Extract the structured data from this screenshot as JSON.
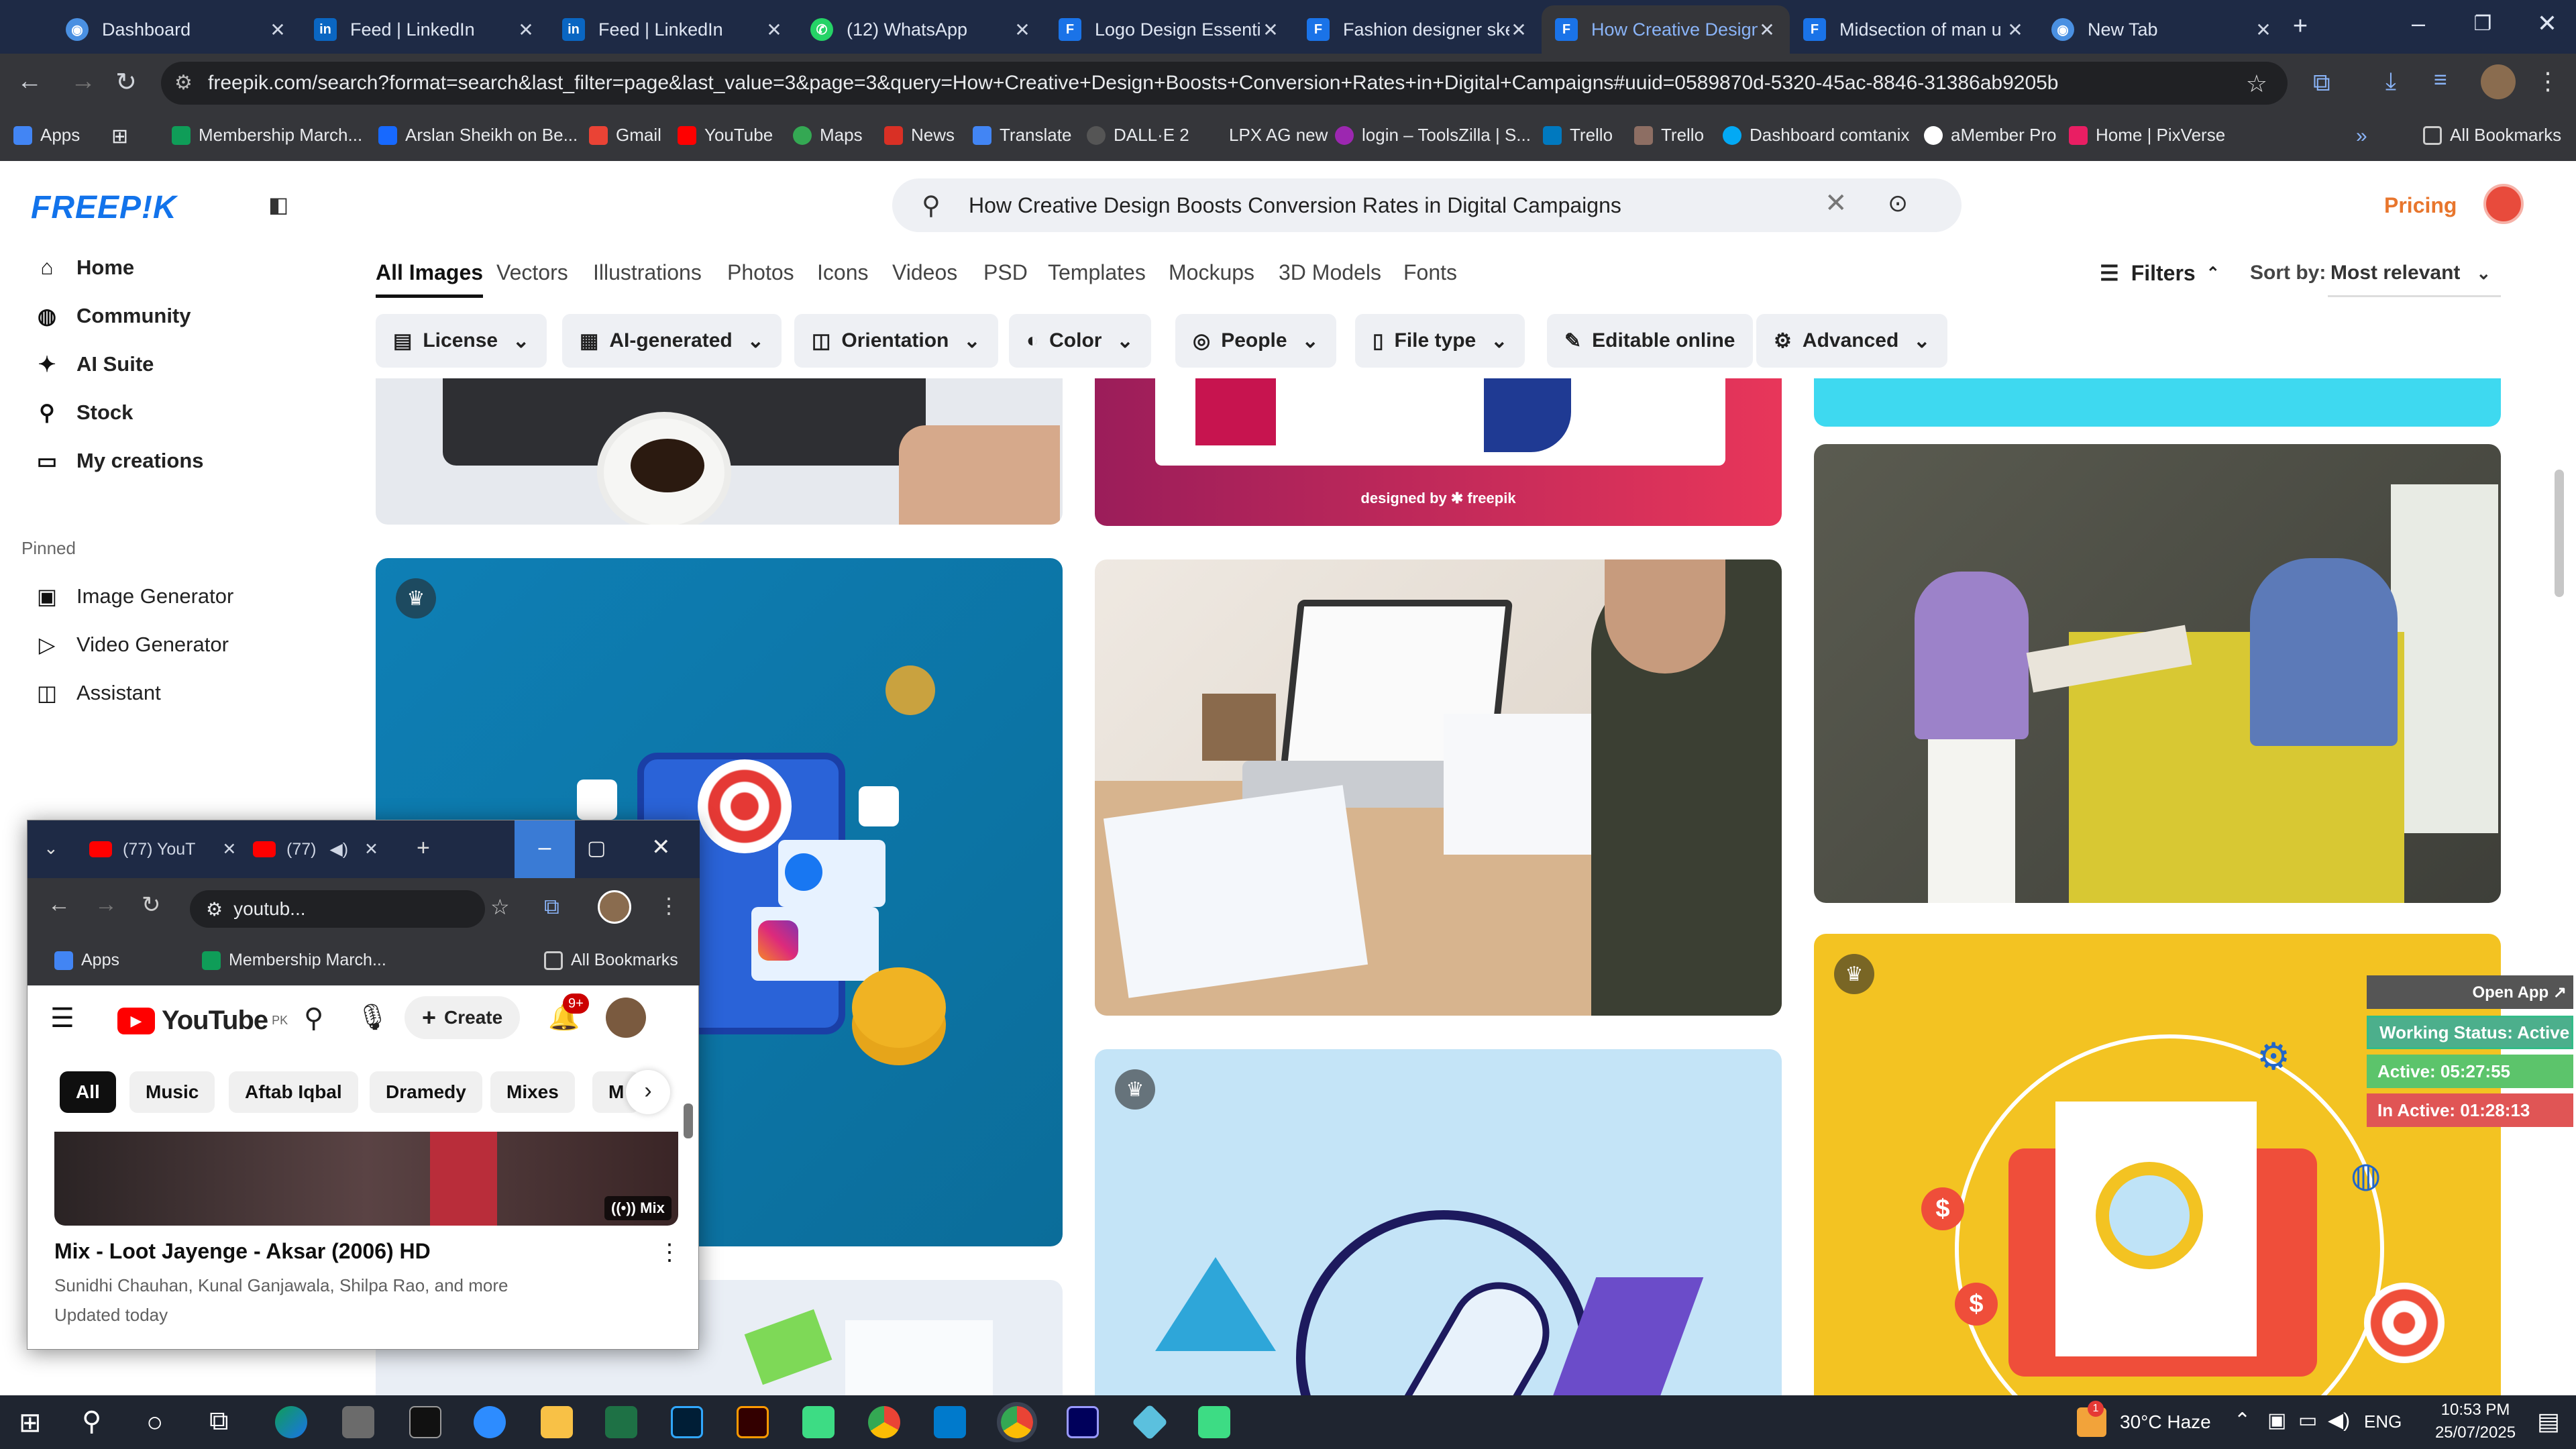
{
  "browser": {
    "tabs": [
      {
        "title": "Dashboard",
        "color": "#4a90e2"
      },
      {
        "title": "Feed | LinkedIn",
        "color": "#0a66c2"
      },
      {
        "title": "Feed | LinkedIn",
        "color": "#0a66c2"
      },
      {
        "title": "(12) WhatsApp",
        "color": "#25d366"
      },
      {
        "title": "Logo Design Essenti",
        "color": "#1a73e8"
      },
      {
        "title": "Fashion designer ske",
        "color": "#1a73e8"
      },
      {
        "title": "How Creative Design",
        "color": "#1a73e8"
      },
      {
        "title": "Midsection of man u",
        "color": "#1a73e8"
      },
      {
        "title": "New Tab",
        "color": "#4a90e2"
      }
    ],
    "url": "freepik.com/search?format=search&last_filter=page&last_value=3&page=3&query=How+Creative+Design+Boosts+Conversion+Rates+in+Digital+Campaigns#uuid=0589870d-5320-45ac-8846-31386ab9205b",
    "bookmarks": [
      "Apps",
      "Membership March...",
      "Arslan Sheikh on Be...",
      "Gmail",
      "YouTube",
      "Maps",
      "News",
      "Translate",
      "DALL·E 2",
      "LPX AG new",
      "login – ToolsZilla | S...",
      "Trello",
      "Trello",
      "Dashboard comtanix",
      "aMember Pro",
      "Home | PixVerse"
    ],
    "all_bookmarks": "All Bookmarks"
  },
  "freepik": {
    "logo": "FREEP!K",
    "search_query": "How Creative Design Boosts Conversion Rates in Digital Campaigns",
    "pricing": "Pricing",
    "sidebar": {
      "items": [
        "Home",
        "Community",
        "AI Suite",
        "Stock",
        "My creations"
      ],
      "pinned_heading": "Pinned",
      "pinned": [
        "Image Generator",
        "Video Generator",
        "Assistant"
      ]
    },
    "tabs": [
      "All Images",
      "Vectors",
      "Illustrations",
      "Photos",
      "Icons",
      "Videos",
      "PSD",
      "Templates",
      "Mockups",
      "3D Models",
      "Fonts"
    ],
    "filters_label": "Filters",
    "sort_label": "Sort by:",
    "sort_value": "Most relevant",
    "chips": [
      "License",
      "AI-generated",
      "Orientation",
      "Color",
      "People",
      "File type",
      "Editable online",
      "Advanced"
    ],
    "designed_by": "designed by ✱ freepik"
  },
  "youtube": {
    "tabs": [
      "(77) YouT",
      "(77)"
    ],
    "url": "youtub...",
    "bookmarks": [
      "Apps",
      "Membership March...",
      "All Bookmarks"
    ],
    "logo": "YouTube",
    "region": "PK",
    "create": "Create",
    "notif_count": "9+",
    "chips": [
      "All",
      "Music",
      "Aftab Iqbal",
      "Dramedy",
      "Mixes",
      "M"
    ],
    "mix_badge": "Mix",
    "video_title": "Mix - Loot Jayenge - Aksar (2006) HD",
    "video_channel": "Sunidhi Chauhan, Kunal Ganjawala, Shilpa Rao, and more",
    "video_updated": "Updated today"
  },
  "tracker": {
    "open_app": "Open App ↗",
    "status": "Working Status: Active",
    "active": "Active: 05:27:55",
    "inactive": "In Active: 01:28:13"
  },
  "taskbar": {
    "weather": "30°C  Haze",
    "lang": "ENG",
    "time": "10:53 PM",
    "date": "25/07/2025",
    "weather_badge": "1"
  }
}
